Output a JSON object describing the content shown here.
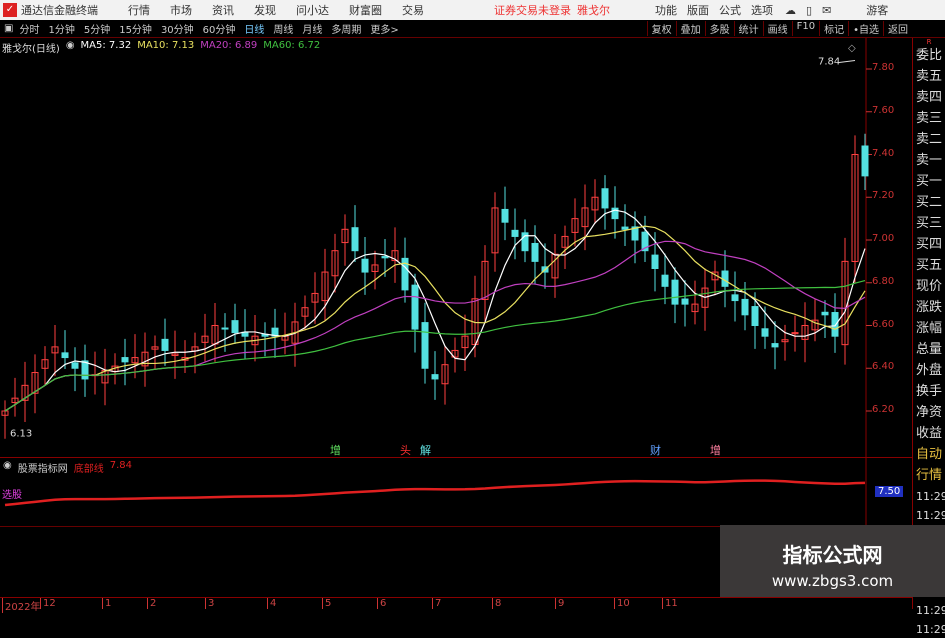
{
  "titlebar": {
    "app": "通达信金融终端",
    "menus": [
      "行情",
      "市场",
      "资讯",
      "发现",
      "问小达",
      "财富圈",
      "交易"
    ],
    "notice": "证券交易未登录",
    "stock": "雅戈尔",
    "right_menus": [
      "功能",
      "版面",
      "公式",
      "选项"
    ],
    "user": "游客"
  },
  "toolbar": {
    "periods": [
      "分时",
      "1分钟",
      "5分钟",
      "15分钟",
      "30分钟",
      "60分钟",
      "日线",
      "周线",
      "月线",
      "多周期",
      "更多>"
    ],
    "active": "日线",
    "buttons": [
      "复权",
      "叠加",
      "多股",
      "统计",
      "画线",
      "F10",
      "标记",
      "•自选",
      "返回"
    ]
  },
  "info": {
    "name": "雅戈尔(日线)",
    "ma5": "MA5: 7.32",
    "ma10": "MA10: 7.13",
    "ma20": "MA20: 6.89",
    "ma60": "MA60: 6.72"
  },
  "colors": {
    "up": "#ff4040",
    "down": "#54e0e0",
    "ma5": "#ffffff",
    "ma10": "#e8e060",
    "ma20": "#c040c0",
    "ma60": "#40c040",
    "indicator": "#e02020"
  },
  "chart_data": {
    "type": "candlestick",
    "price_ticks": [
      "7.80",
      "7.60",
      "7.40",
      "7.20",
      "7.00",
      "6.80",
      "6.60",
      "6.40",
      "6.20"
    ],
    "high_label": "7.84",
    "low_label": "6.13",
    "close_keypoints": [
      [
        0,
        6.2
      ],
      [
        5,
        6.5
      ],
      [
        8,
        6.35
      ],
      [
        13,
        6.45
      ],
      [
        15,
        6.5
      ],
      [
        18,
        6.45
      ],
      [
        21,
        6.6
      ],
      [
        24,
        6.55
      ],
      [
        28,
        6.55
      ],
      [
        31,
        6.75
      ],
      [
        34,
        7.05
      ],
      [
        36,
        6.85
      ],
      [
        39,
        6.95
      ],
      [
        42,
        6.4
      ],
      [
        43,
        6.35
      ],
      [
        46,
        6.55
      ],
      [
        48,
        6.9
      ],
      [
        49,
        7.15
      ],
      [
        52,
        6.95
      ],
      [
        54,
        6.85
      ],
      [
        57,
        7.1
      ],
      [
        59,
        7.2
      ],
      [
        62,
        7.05
      ],
      [
        64,
        6.95
      ],
      [
        67,
        6.7
      ],
      [
        69,
        6.7
      ],
      [
        71,
        6.85
      ],
      [
        74,
        6.65
      ],
      [
        77,
        6.5
      ],
      [
        80,
        6.6
      ],
      [
        82,
        6.65
      ],
      [
        83,
        6.55
      ],
      [
        84,
        6.9
      ],
      [
        85,
        7.4
      ],
      [
        86,
        7.3
      ]
    ],
    "markers": [
      {
        "bar": 33,
        "text": "增",
        "color": "#60e060"
      },
      {
        "bar": 40,
        "text": "头",
        "color": "#ff3030"
      },
      {
        "bar": 42,
        "text": "解",
        "color": "#60e0e0"
      },
      {
        "bar": 65,
        "text": "财",
        "color": "#60a0ff"
      },
      {
        "bar": 71,
        "text": "增",
        "color": "#ff80a0"
      }
    ],
    "months": [
      "2022年",
      "12",
      "1",
      "2",
      "3",
      "4",
      "5",
      "6",
      "7",
      "8",
      "9",
      "10",
      "11"
    ]
  },
  "indicator": {
    "name": "股票指标网",
    "line_label": "底部线",
    "line_value": "7.84",
    "tag": "选股",
    "axis_value": "7.50"
  },
  "right_panel": {
    "top": "R",
    "labels": [
      "委比",
      "卖五",
      "卖四",
      "卖三",
      "卖二",
      "卖一",
      "买一",
      "买二",
      "买三",
      "买四",
      "买五",
      "现价",
      "涨跌",
      "涨幅",
      "总量",
      "外盘",
      "换手",
      "净资",
      "收益",
      "自动",
      "行情"
    ],
    "times": [
      "11:29",
      "11:29",
      "11:29",
      "11:29",
      "11:29",
      "11:29",
      "11:29",
      "11:29"
    ]
  },
  "watermark": {
    "title": "指标公式网",
    "url": "www.zbgs3.com"
  }
}
